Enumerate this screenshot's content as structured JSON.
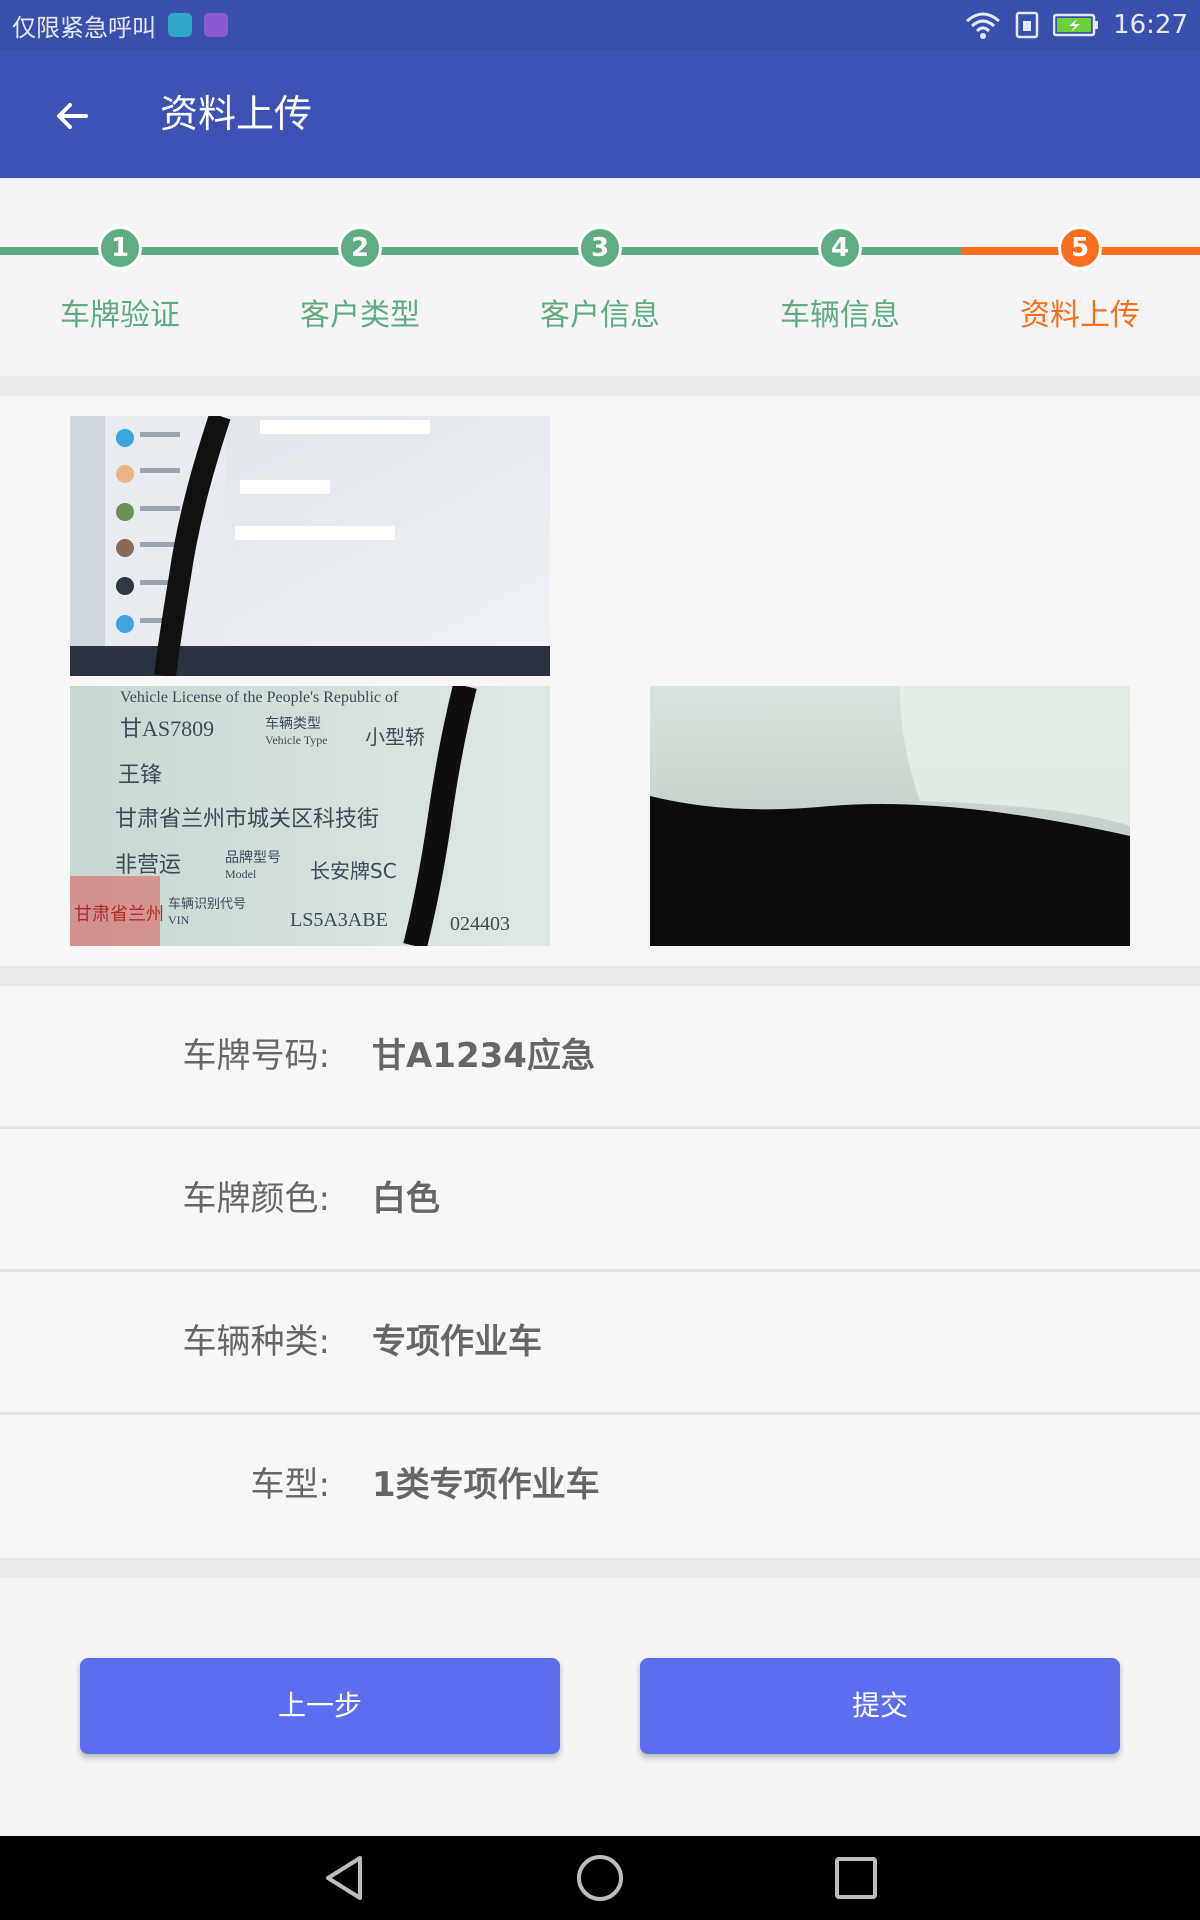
{
  "status_bar": {
    "carrier_text": "仅限紧急呼叫",
    "time": "16:27",
    "icons": [
      "android-debug-icon",
      "image-notification-icon",
      "wifi-icon",
      "sim-icon",
      "battery-charging-icon"
    ]
  },
  "app_bar": {
    "title": "资料上传",
    "back_icon": "arrow-left-icon"
  },
  "stepper": {
    "done_color": "#5fab82",
    "active_color": "#fb6e1d",
    "steps": [
      {
        "number": "1",
        "label": "车牌验证",
        "state": "done"
      },
      {
        "number": "2",
        "label": "客户类型",
        "state": "done"
      },
      {
        "number": "3",
        "label": "客户信息",
        "state": "done"
      },
      {
        "number": "4",
        "label": "车辆信息",
        "state": "done"
      },
      {
        "number": "5",
        "label": "资料上传",
        "state": "active"
      }
    ]
  },
  "photos": {
    "license_photo_text": {
      "header": "Vehicle License of the People's Republic of",
      "plate": "甘AS7809",
      "vehicle_type_label": "车辆类型",
      "vehicle_type_en": "Vehicle Type",
      "vehicle_type": "小型轿",
      "owner": "王锋",
      "address": "甘肃省兰州市城关区科技街",
      "use_character": "非营运",
      "model_label": "品牌型号",
      "model_en": "Model",
      "model": "长安牌SC",
      "vin_label": "车辆识别代号",
      "vin_en": "VIN",
      "vin": "LS5A3ABE",
      "vin_tail": "024403",
      "stamp": "甘肃省兰州"
    }
  },
  "info": {
    "rows": [
      {
        "label": "车牌号码:",
        "value": "甘A1234应急"
      },
      {
        "label": "车牌颜色:",
        "value": "白色"
      },
      {
        "label": "车辆种类:",
        "value": "专项作业车"
      },
      {
        "label": "车型:",
        "value": "1类专项作业车"
      }
    ]
  },
  "actions": {
    "prev_label": "上一步",
    "submit_label": "提交",
    "button_color": "#5b6ef0"
  },
  "nav_bar": {
    "icons": [
      "nav-back-icon",
      "nav-home-icon",
      "nav-recents-icon"
    ]
  }
}
